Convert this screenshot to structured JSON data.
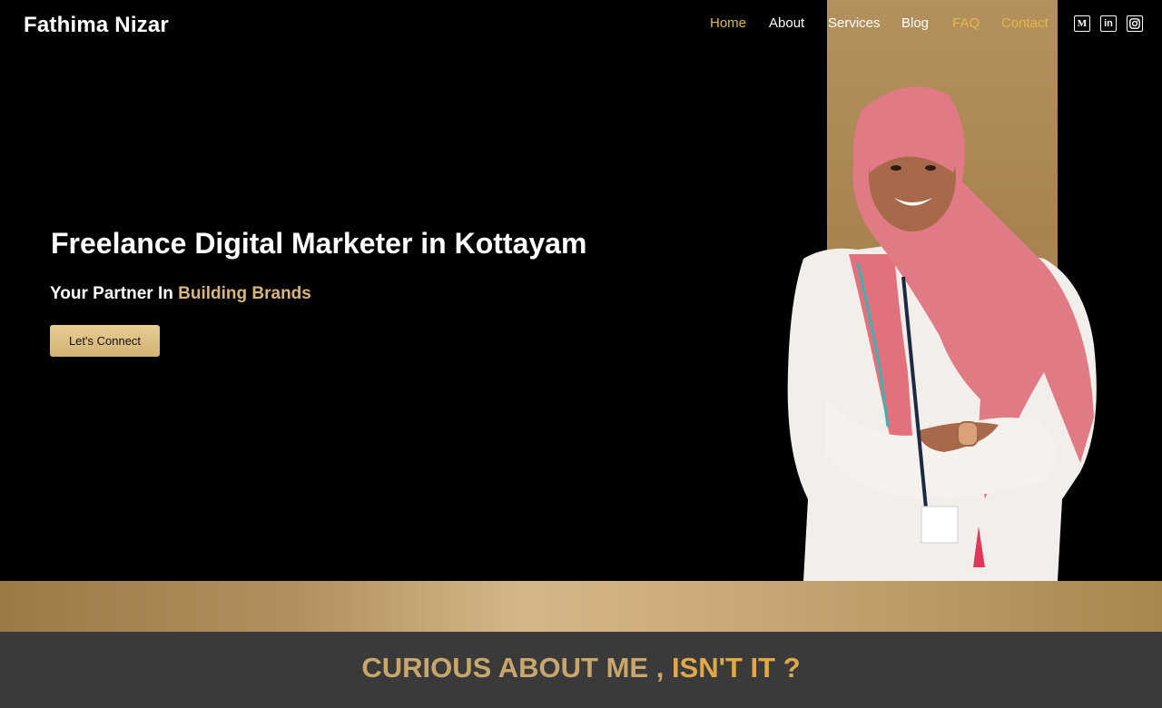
{
  "header": {
    "logo": "Fathima Nizar",
    "nav": [
      {
        "label": "Home",
        "active": true
      },
      {
        "label": "About",
        "active": false
      },
      {
        "label": "Services",
        "active": false
      },
      {
        "label": "Blog",
        "active": false
      },
      {
        "label": "FAQ",
        "active": false
      },
      {
        "label": "Contact",
        "active": false
      }
    ],
    "social": [
      {
        "icon": "medium-icon",
        "glyph": "M"
      },
      {
        "icon": "linkedin-icon",
        "glyph": "in"
      },
      {
        "icon": "instagram-icon",
        "glyph": ""
      }
    ]
  },
  "hero": {
    "title": "Freelance Digital Marketer in Kottayam",
    "subtitle_prefix": "Your Partner In ",
    "subtitle_accent": "Building Brands",
    "cta_label": "Let's Connect"
  },
  "about_teaser": {
    "title_part1": "CURIOUS ABOUT ME ,",
    "title_part2": " ISN'T IT ?"
  },
  "colors": {
    "accent_gold": "#e5b84a",
    "subtitle_gold": "#d9b67c",
    "panel_gold": "#b3915e",
    "dark_section": "#3a3a3a"
  }
}
